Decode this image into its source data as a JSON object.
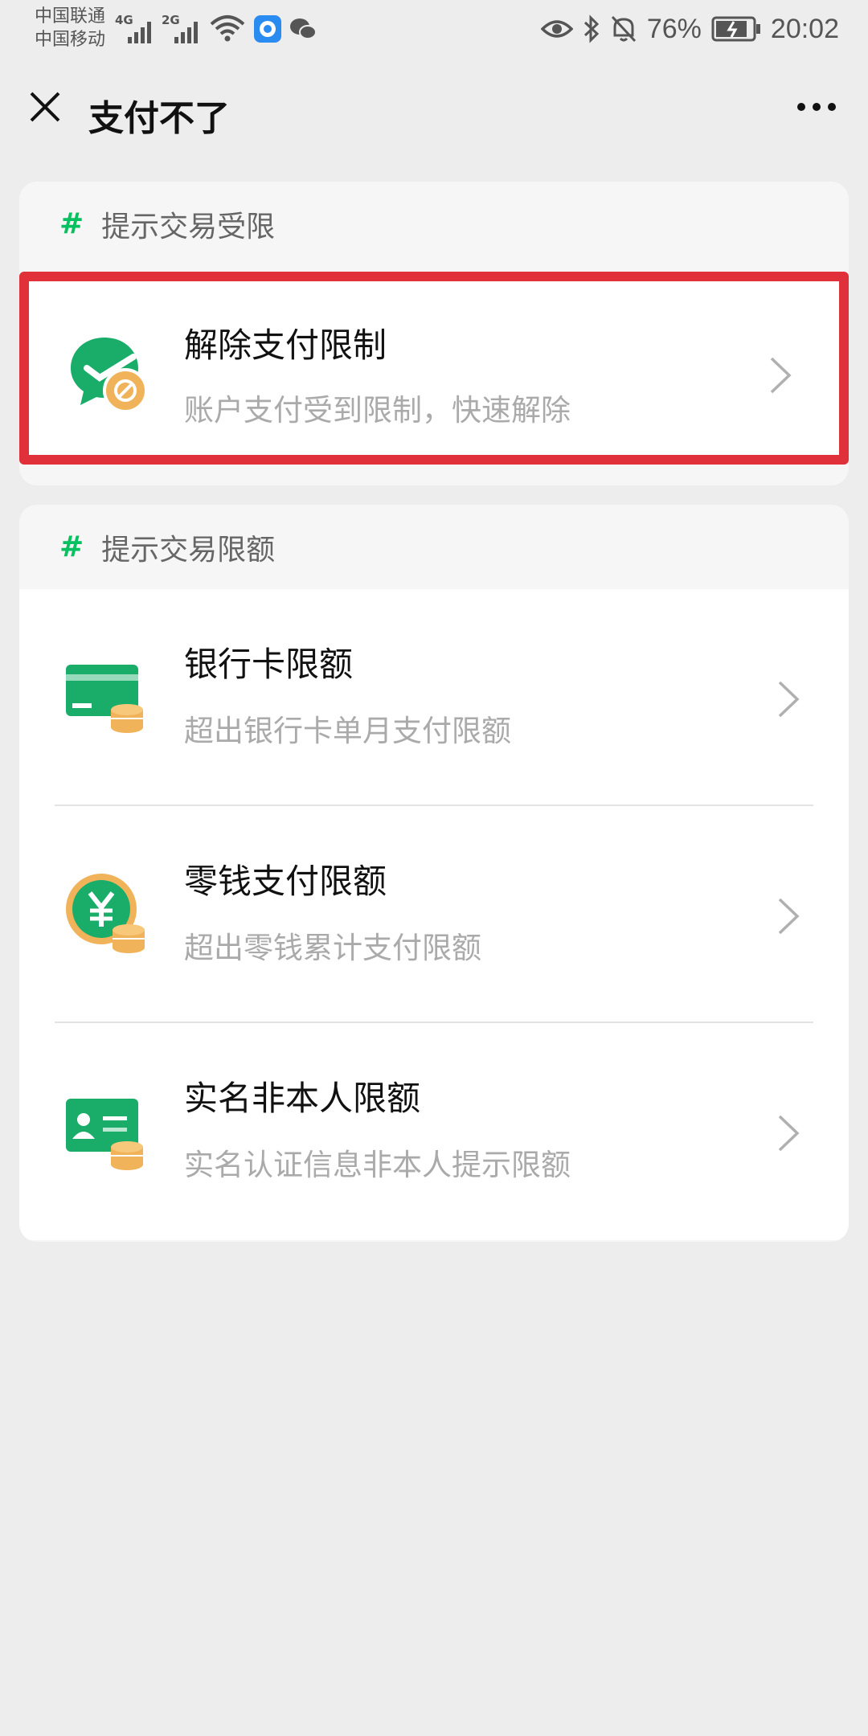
{
  "status_bar": {
    "carrier_1": "中国联通",
    "carrier_2": "中国移动",
    "network_1": "4G",
    "network_2": "2G",
    "battery": "76%",
    "time": "20:02"
  },
  "nav": {
    "title": "支付不了"
  },
  "section_1": {
    "header": "提示交易受限",
    "items": [
      {
        "title": "解除支付限制",
        "desc": "账户支付受到限制，快速解除",
        "icon": "wechat-pay-blocked-icon"
      }
    ]
  },
  "section_2": {
    "header": "提示交易限额",
    "items": [
      {
        "title": "银行卡限额",
        "desc": "超出银行卡单月支付限额",
        "icon": "bank-card-coins-icon"
      },
      {
        "title": "零钱支付限额",
        "desc": "超出零钱累计支付限额",
        "icon": "yuan-coins-icon"
      },
      {
        "title": "实名非本人限额",
        "desc": "实名认证信息非本人提示限额",
        "icon": "id-card-coins-icon"
      }
    ]
  },
  "colors": {
    "accent_green": "#07c160",
    "highlight_red": "#e0303a",
    "coin_orange": "#f0b35a",
    "background": "#ededed"
  }
}
